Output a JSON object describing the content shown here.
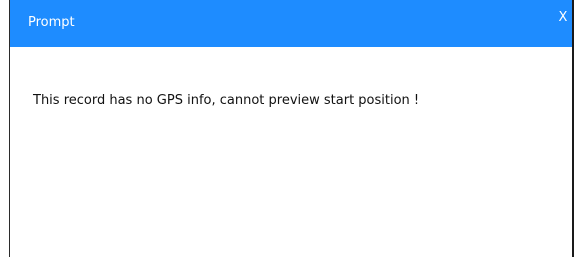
{
  "dialog": {
    "title": "Prompt",
    "close_label": "X",
    "message": "This record has no GPS info, cannot preview start position !"
  },
  "colors": {
    "titlebar": "#1e8cff",
    "title_text": "#ffffff",
    "body_background": "#ffffff",
    "message_text": "#111111"
  }
}
